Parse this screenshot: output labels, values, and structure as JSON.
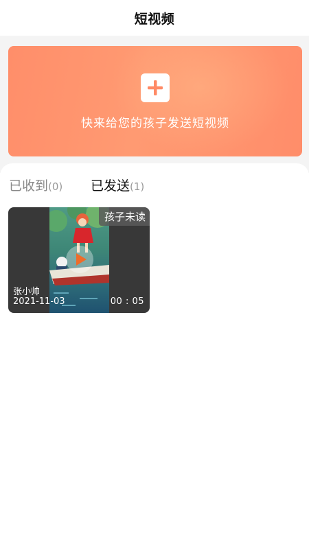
{
  "header": {
    "title": "短视频"
  },
  "banner": {
    "add_icon": "plus-icon",
    "text": "快来给您的孩子发送短视频",
    "background_color": "#ff9470"
  },
  "tabs": [
    {
      "label": "已收到",
      "count": "(0)",
      "active": false
    },
    {
      "label": "已发送",
      "count": "(1)",
      "active": true
    }
  ],
  "accent_color": "#ef6c2a",
  "videos": [
    {
      "status_badge": "孩子未读",
      "sender": "张小帅",
      "date": "2021-11-03",
      "duration": "00 : 05",
      "play_icon": "play-icon"
    }
  ]
}
